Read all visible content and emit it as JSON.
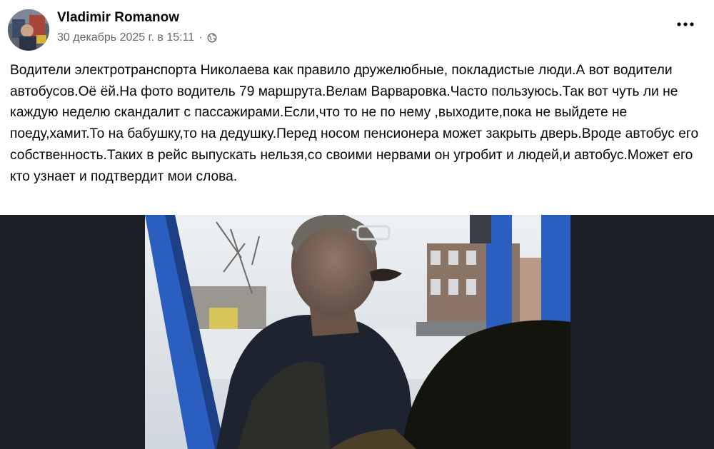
{
  "post": {
    "author": "Vladimir Romanow",
    "timestamp": "30 декабрь 2025 г. в 15:11",
    "separator": "·",
    "audience_icon": "globe-icon",
    "more_icon": "more-options-icon",
    "text": "Водители электротранспорта Николаева как правило дружелюбные, покладистые люди.А вот водители автобусов.Оё ёй.На фото водитель 79 маршрута.Велам Варваровка.Часто пользуюсь.Так вот чуть ли не каждую неделю скандалит с пассажирами.Если,что то не по нему ,выходите,пока не выйдете не поеду,хамит.То на бабушку,то на дедушку.Перед носом пенсионера может закрыть дверь.Вроде автобус его собственность.Таких в рейс выпускать нельзя,со своими нервами он угробит и людей,и автобус.Может его кто узнает и подтвердит мои слова."
  },
  "colors": {
    "background": "#ffffff",
    "media_background": "#1c1e26",
    "secondary_text": "#65676b",
    "primary_text": "#050505",
    "bus_frame_blue": "#2a5fc0"
  }
}
